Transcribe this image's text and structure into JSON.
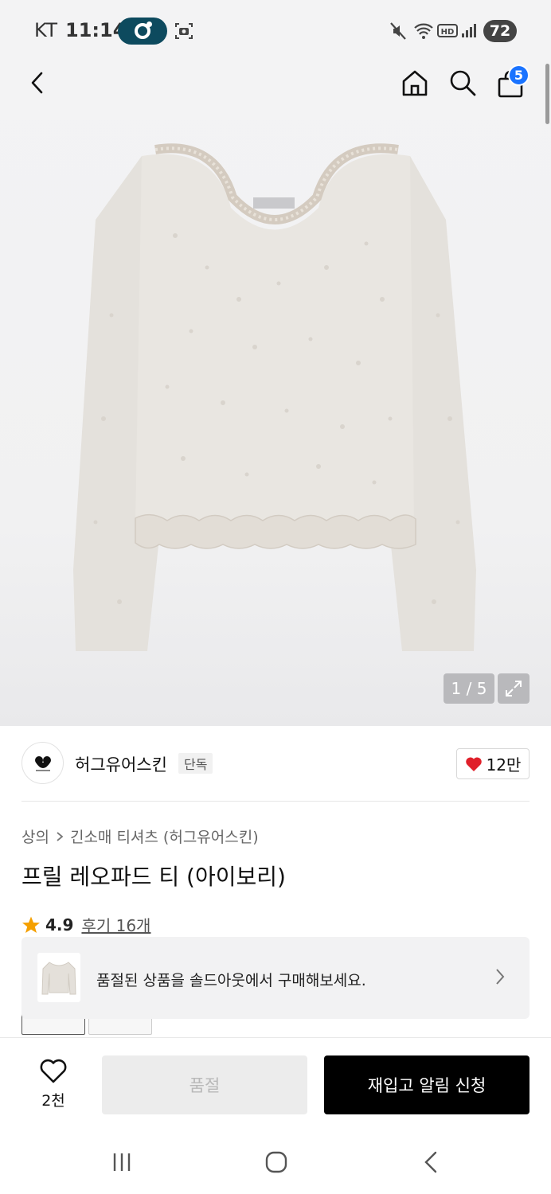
{
  "status_bar": {
    "carrier": "KT",
    "time": "11:14",
    "battery": "72"
  },
  "header": {
    "cart_count": "5"
  },
  "gallery": {
    "counter": "1 / 5"
  },
  "brand": {
    "name": "허그유어스킨",
    "tag": "단독",
    "likes": "12만"
  },
  "breadcrumb": {
    "category": "상의",
    "subcategory": "긴소매 티셔츠 (허그유어스킨)"
  },
  "product": {
    "title": "프릴 레오파드 티 (아이보리)",
    "rating": "4.9",
    "reviews": "후기 16개"
  },
  "soldout_banner": {
    "text": "품절된 상품을 솔드아웃에서 구매해보세요."
  },
  "action_bar": {
    "wish_count": "2천",
    "soldout_label": "품절",
    "restock_label": "재입고 알림 신청"
  },
  "colors": {
    "accent_black": "#000000",
    "badge_blue": "#1a73ff",
    "heart_red": "#e0202a",
    "star_orange": "#f5a000"
  }
}
